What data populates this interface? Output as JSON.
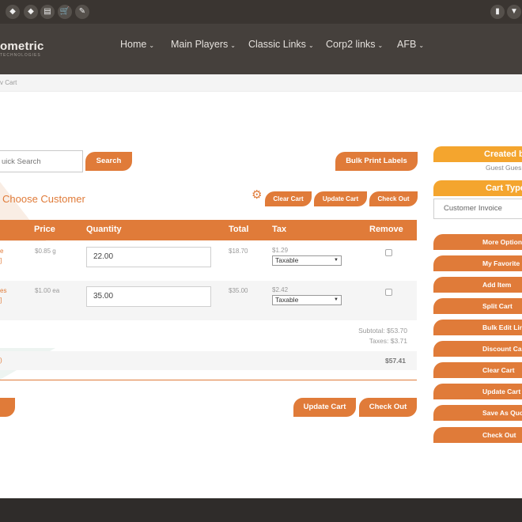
{
  "topbar": {
    "icons": [
      "gitlab-icon",
      "gitlab-icon",
      "book-icon",
      "cart-icon",
      "magic-wand-icon"
    ],
    "right_icons": [
      "bookmark-icon",
      "shirt-icon"
    ]
  },
  "header": {
    "logo": "ometric",
    "logo_sub": "TECHNOLOGIES",
    "nav": [
      {
        "label": "Home"
      },
      {
        "label": "Main Players"
      },
      {
        "label": "Classic Links"
      },
      {
        "label": "Corp2 links"
      },
      {
        "label": "AFB"
      }
    ]
  },
  "breadcrumb": "v Cart",
  "search": {
    "placeholder": "uick Search",
    "button": "Search"
  },
  "bulk_print": "Bulk Print Labels",
  "customer": {
    "title": "Choose Customer"
  },
  "actions": {
    "clear": "Clear Cart",
    "update": "Update Cart",
    "checkout": "Check Out"
  },
  "table": {
    "headers": {
      "price": "Price",
      "quantity": "Quantity",
      "total": "Total",
      "tax": "Tax",
      "remove": "Remove"
    },
    "rows": [
      {
        "name": "e",
        "sub": "]",
        "price": "$0.85 g",
        "quantity": "22.00",
        "total": "$18.70",
        "tax": "$1.29",
        "tax_type": "Taxable"
      },
      {
        "name": "es",
        "sub": "]",
        "price": "$1.00 ea",
        "quantity": "35.00",
        "total": "$35.00",
        "tax": "$2.42",
        "tax_type": "Taxable"
      }
    ]
  },
  "totals": {
    "subtotal": "Subtotal: $53.70",
    "taxes": "Taxes: $3.71",
    "grand": "$57.41",
    "grand_left": ")"
  },
  "bottom": {
    "update": "Update Cart",
    "checkout": "Check Out",
    "left_btn": "+"
  },
  "sidebar": {
    "created_by": "Created b",
    "guest": "Guest Gues",
    "cart_type": "Cart Type",
    "customer_invoice": "Customer Invoice",
    "buttons": [
      "More Options",
      "My Favorite",
      "Add Item",
      "Split Cart",
      "Bulk Edit Line",
      "Discount Cal",
      "Clear Cart",
      "Update Cart",
      "Save As Quo",
      "Check Out"
    ]
  },
  "colors": {
    "accent": "#e07b39",
    "accent_light": "#f4a52e",
    "header": "#45403c",
    "topbar": "#3a3531"
  }
}
